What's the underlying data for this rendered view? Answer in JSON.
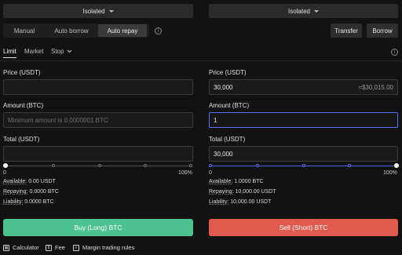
{
  "left": {
    "mode_select": "Isolated",
    "borrow_modes": [
      "Manual",
      "Auto borrow",
      "Auto repay"
    ],
    "active_mode": "Auto repay",
    "tabs": [
      "Limit",
      "Market",
      "Stop"
    ],
    "price": {
      "label": "Price (USDT)",
      "value": ""
    },
    "amount": {
      "label": "Amount (BTC)",
      "placeholder": "Minimum amount is 0.0000001 BTC"
    },
    "total": {
      "label": "Total (USDT)",
      "value": ""
    },
    "slider": {
      "min_label": "0",
      "max_label": "100%",
      "fraction": 0
    },
    "stats": {
      "available_k": "Available:",
      "available_v": "0.00 USDT",
      "repaying_k": "Repaying:",
      "repaying_v": "0.0000 BTC",
      "liability_k": "Liability:",
      "liability_v": "0.0000 BTC"
    },
    "buy_button": "Buy (Long) BTC"
  },
  "right": {
    "mode_select": "Isolated",
    "transfer_button": "Transfer",
    "borrow_button": "Borrow",
    "price": {
      "label": "Price (USDT)",
      "value": "30,000",
      "suffix": "≈$30,015.00"
    },
    "amount": {
      "label": "Amount (BTC)",
      "value": "1"
    },
    "total": {
      "label": "Total (USDT)",
      "value": "30,000"
    },
    "slider": {
      "min_label": "0",
      "max_label": "100%",
      "fraction": 1
    },
    "stats": {
      "available_k": "Available:",
      "available_v": "1.0000 BTC",
      "repaying_k": "Repaying:",
      "repaying_v": "10,000.00 USDT",
      "liability_k": "Liability:",
      "liability_v": "10,000.00 USDT"
    },
    "sell_button": "Sell (Short) BTC"
  },
  "footer": {
    "calculator": "Calculator",
    "fee": "Fee",
    "rules": "Margin trading rules"
  },
  "colors": {
    "buy": "#4cc28e",
    "sell": "#e05a4e",
    "accent": "#5b6ff0"
  }
}
